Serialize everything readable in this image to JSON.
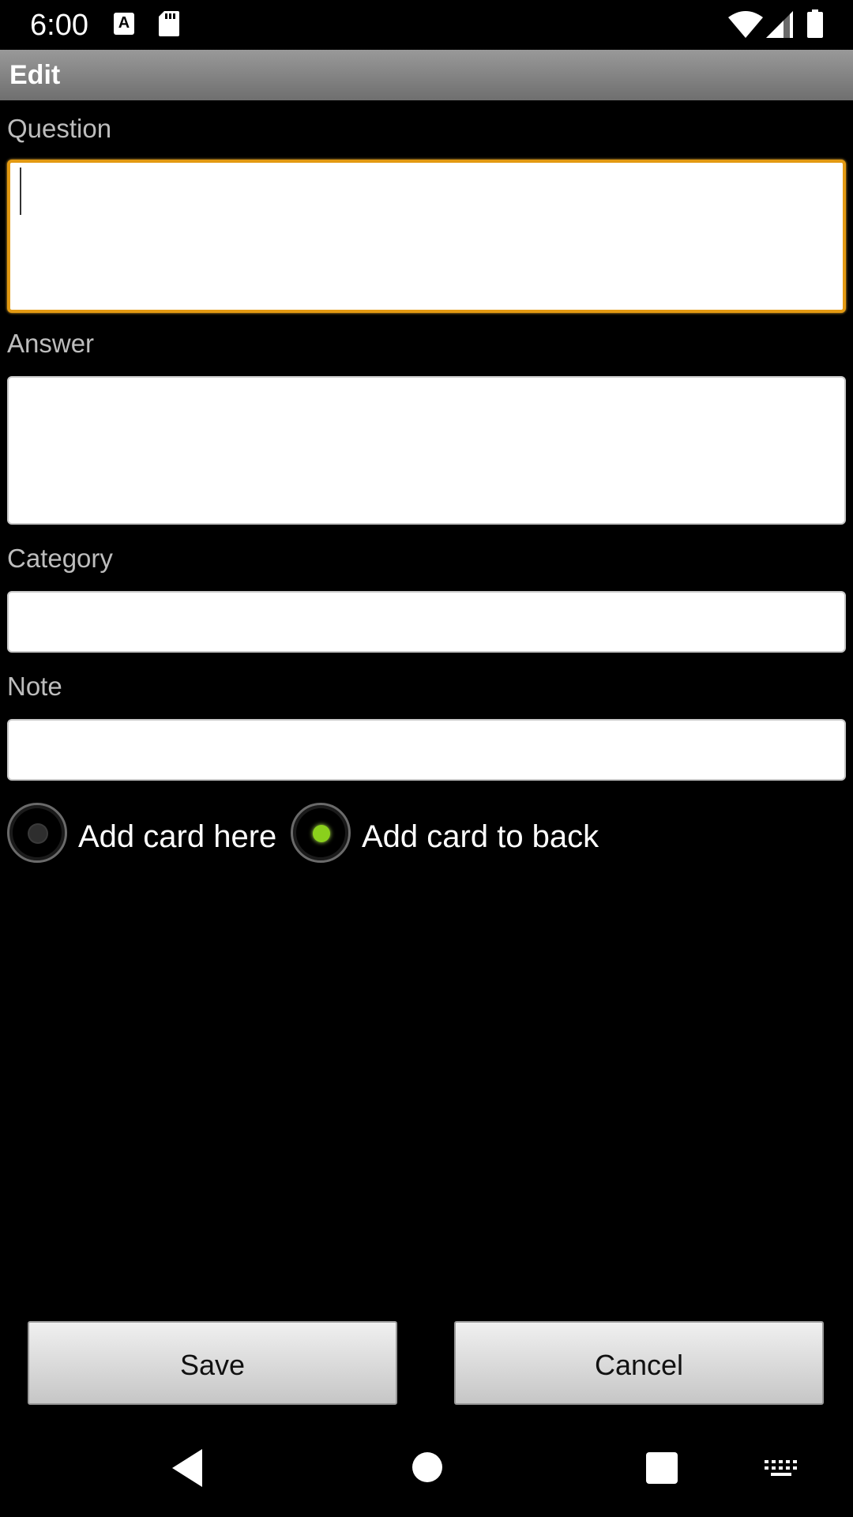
{
  "status_bar": {
    "time": "6:00",
    "icons": [
      "keyboard-a-icon",
      "sd-card-icon",
      "wifi-icon",
      "cell-signal-icon",
      "battery-icon"
    ]
  },
  "action_bar": {
    "title": "Edit"
  },
  "form": {
    "question": {
      "label": "Question",
      "value": ""
    },
    "answer": {
      "label": "Answer",
      "value": ""
    },
    "category": {
      "label": "Category",
      "value": ""
    },
    "note": {
      "label": "Note",
      "value": ""
    }
  },
  "radios": {
    "add_here": {
      "label": "Add card here",
      "checked": false
    },
    "add_back": {
      "label": "Add card to back",
      "checked": true
    }
  },
  "buttons": {
    "save": "Save",
    "cancel": "Cancel"
  },
  "nav_bar": {
    "icons": [
      "back-icon",
      "home-icon",
      "recents-icon",
      "keyboard-icon"
    ]
  },
  "colors": {
    "focus_border": "#e39a12",
    "radio_selected": "#8ad01c",
    "action_bar": "#8a8a8a"
  }
}
